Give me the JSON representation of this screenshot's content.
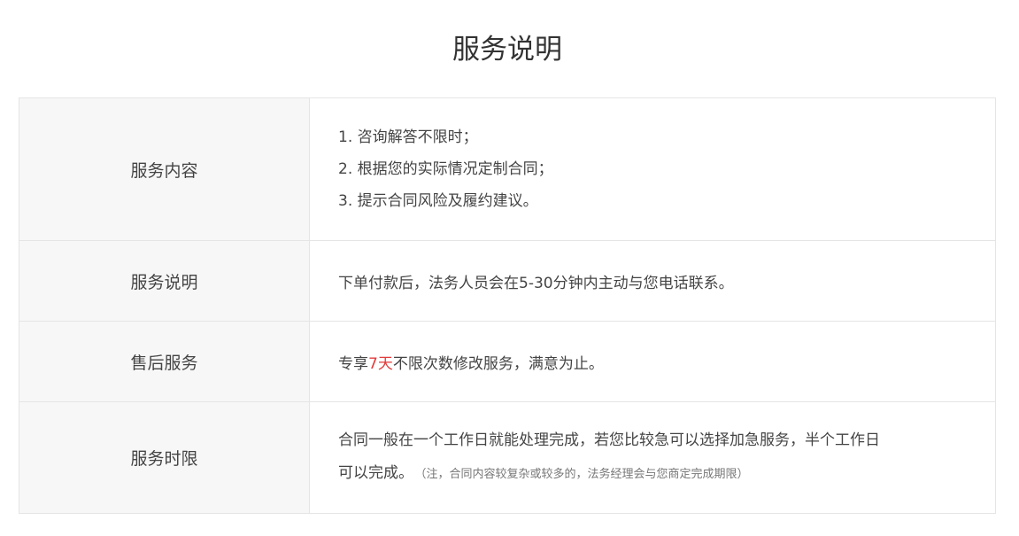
{
  "title": "服务说明",
  "rows": [
    {
      "label": "服务内容",
      "items": [
        "1. 咨询解答不限时；",
        "2. 根据您的实际情况定制合同；",
        "3. 提示合同风险及履约建议。"
      ]
    },
    {
      "label": "服务说明",
      "text": "下单付款后，法务人员会在5-30分钟内主动与您电话联系。"
    },
    {
      "label": "售后服务",
      "text_before": "专享",
      "highlight": "7天",
      "text_after": "不限次数修改服务，满意为止。",
      "highlight_color": "#e23b3b"
    },
    {
      "label": "服务时限",
      "text": "合同一般在一个工作日就能处理完成，若您比较急可以选择加急服务，半个工作日可以完成。",
      "note": "（注，合同内容较复杂或较多的，法务经理会与您商定完成期限）"
    }
  ]
}
